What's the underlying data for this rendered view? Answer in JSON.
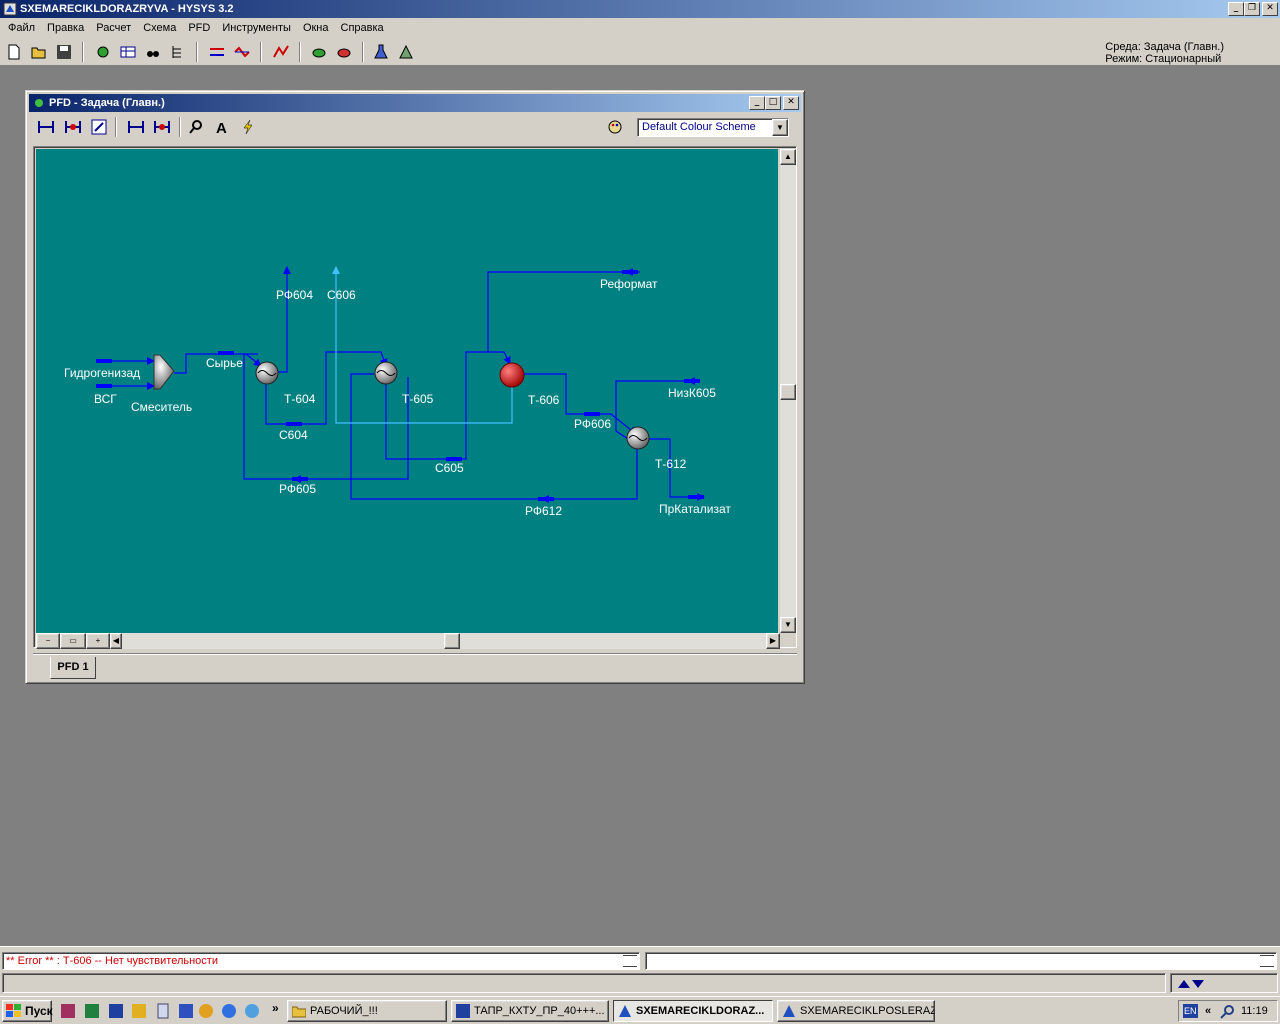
{
  "app": {
    "title": "SXEMARECIKLDORAZRYVA - HYSYS 3.2"
  },
  "menu": [
    "Файл",
    "Правка",
    "Расчет",
    "Схема",
    "PFD",
    "Инструменты",
    "Окна",
    "Справка"
  ],
  "env": {
    "line1": "Среда: Задача (Главн.)",
    "line2": "Режим: Стационарный"
  },
  "pfd": {
    "title": "PFD - Задача (Главн.)",
    "color_scheme": "Default Colour Scheme",
    "tab": "PFD 1",
    "labels": {
      "gidro": "Гидрогенизад",
      "vsg": "ВСГ",
      "mixer": "Смеситель",
      "syrie": "Сырье",
      "rf604": "РФ604",
      "c606": "С606",
      "t604": "Т-604",
      "c604": "С604",
      "t605": "Т-605",
      "c605": "С605",
      "rf605": "РФ605",
      "reformat": "Реформат",
      "t606": "Т-606",
      "nizk605": "НизК605",
      "rf606": "РФ606",
      "t612": "Т-612",
      "rf612": "РФ612",
      "prkat": "ПрКатализат"
    }
  },
  "status": {
    "error": "** Error ** : Т-606 -- Нет чувствительности"
  },
  "taskbar": {
    "start": "Пуск",
    "tasks": [
      "РАБОЧИЙ_!!!",
      "ТАПР_КХТУ_ПР_40+++...",
      "SXEMARECIKLDORAZ...",
      "SXEMARECIKLPOSLERAZ..."
    ],
    "lang": "EN",
    "clock": "11:19"
  }
}
